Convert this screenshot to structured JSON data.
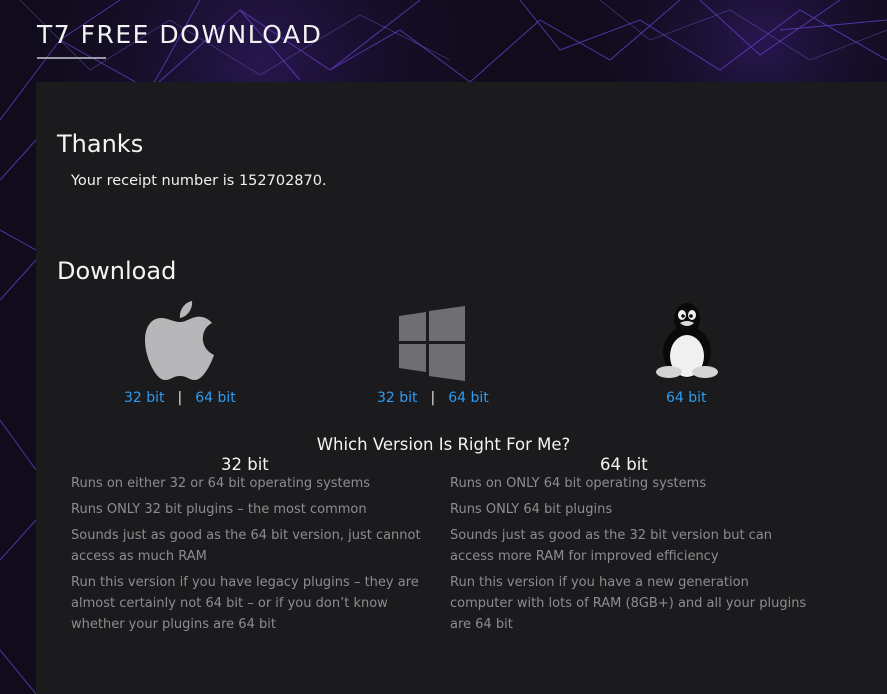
{
  "header": {
    "title": "T7 FREE DOWNLOAD"
  },
  "thanks": {
    "heading": "Thanks",
    "receipt_text": "Your receipt number is 152702870."
  },
  "download": {
    "heading": "Download",
    "separator": "|",
    "platforms": [
      {
        "icon": "apple-icon",
        "links": [
          "32 bit",
          "64 bit"
        ]
      },
      {
        "icon": "windows-icon",
        "links": [
          "32 bit",
          "64 bit"
        ]
      },
      {
        "icon": "linux-tux-icon",
        "links": [
          "64 bit"
        ]
      }
    ]
  },
  "comparison": {
    "heading": "Which Version Is Right For Me?",
    "col32": {
      "title": "32 bit",
      "notes": [
        "Runs on either 32 or 64 bit operating systems",
        "Runs ONLY 32 bit plugins – the most common",
        "Sounds just as good as the 64 bit version, just cannot access as much RAM",
        "Run this version if you have legacy plugins – they are almost certainly not 64 bit – or if you don’t know whether your plugins are 64 bit"
      ]
    },
    "col64": {
      "title": "64 bit",
      "notes": [
        "Runs on ONLY 64 bit operating systems",
        "Runs ONLY 64 bit plugins",
        "Sounds just as good as the 32 bit version but can access more RAM for improved efficiency",
        "Run this version if you have a new generation computer with lots of RAM (8GB+) and all your plugins are 64 bit"
      ]
    }
  },
  "colors": {
    "background": "#100c1c",
    "panel": "#1b1b1d",
    "link": "#2e9bf0",
    "muted_text": "#8d8d90",
    "network_lines": "#6a3fd0"
  }
}
